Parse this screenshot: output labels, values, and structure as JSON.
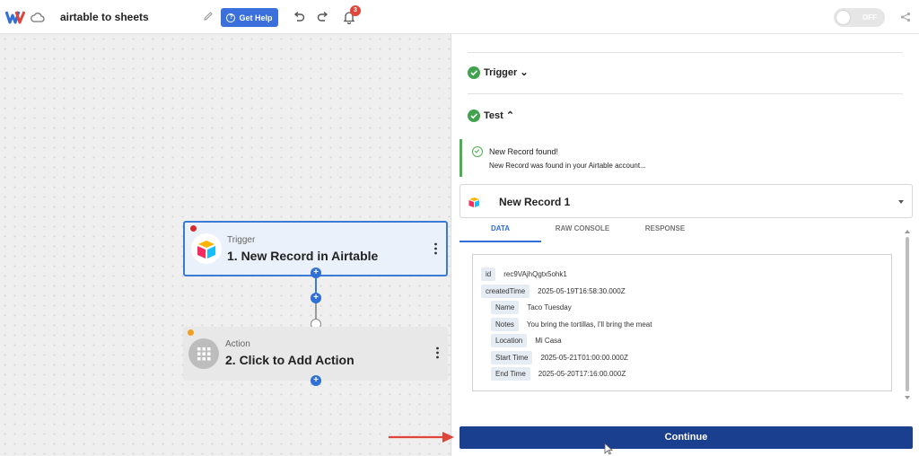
{
  "header": {
    "title": "airtable to sheets",
    "help_label": "Get Help",
    "notification_count": "3",
    "toggle_label": "OFF"
  },
  "canvas": {
    "trigger_card": {
      "type": "Trigger",
      "name": "1. New Record in Airtable"
    },
    "action_card": {
      "type": "Action",
      "name": "2. Click to Add Action"
    }
  },
  "panel": {
    "steps": [
      {
        "label": "Trigger",
        "status": "complete"
      },
      {
        "label": "Test",
        "status": "complete"
      }
    ],
    "alert": {
      "title": "New Record found!",
      "message": "New Record was found in your Airtable account..."
    },
    "record": {
      "name": "New Record 1"
    },
    "tabs": [
      {
        "label": "DATA",
        "active": true
      },
      {
        "label": "RAW CONSOLE",
        "active": false
      },
      {
        "label": "RESPONSE",
        "active": false
      }
    ],
    "fields": [
      {
        "key": "id",
        "value": "rec9VAjhQgtx5ohk1"
      },
      {
        "key": "createdTime",
        "value": "2025-05-19T16:58:30.000Z"
      },
      {
        "key": "Name",
        "value": "Taco Tuesday"
      },
      {
        "key": "Notes",
        "value": "You bring the tortillas, I'll bring the meat"
      },
      {
        "key": "Location",
        "value": "Mi Casa"
      },
      {
        "key": "Start Time",
        "value": "2025-05-21T01:00:00.000Z"
      },
      {
        "key": "End Time",
        "value": "2025-05-20T17:16:00.000Z"
      }
    ],
    "continue_label": "Continue"
  },
  "colors": {
    "primary": "#2f6fd6",
    "continue_bg": "#1a3f8f",
    "success": "#3fa34d",
    "arrow": "#e0453b"
  }
}
